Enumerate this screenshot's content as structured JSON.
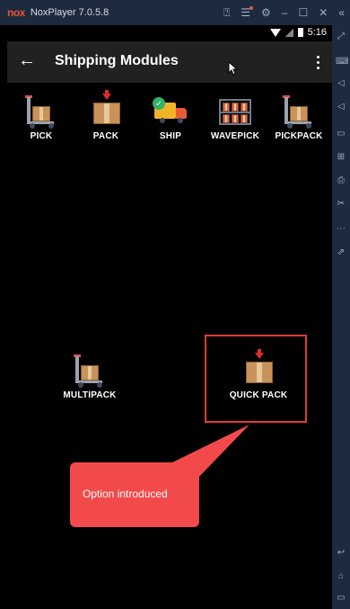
{
  "emulator": {
    "logo": "nox",
    "title": "NoxPlayer 7.0.5.8",
    "controls": [
      "help-icon",
      "menu-icon",
      "settings-icon",
      "minimize-icon",
      "maximize-icon",
      "close-icon",
      "collapse-icon"
    ]
  },
  "status_bar": {
    "time": "5:16"
  },
  "app_bar": {
    "title": "Shipping Modules"
  },
  "modules": [
    {
      "label": "PICK",
      "icon": "trolley-box-icon"
    },
    {
      "label": "PACK",
      "icon": "box-arrow-icon"
    },
    {
      "label": "SHIP",
      "icon": "truck-check-icon"
    },
    {
      "label": "WAVEPICK",
      "icon": "shelf-icon"
    },
    {
      "label": "PICKPACK",
      "icon": "trolley-box-icon"
    },
    {
      "label": "MULTIPACK",
      "icon": "trolley-box-icon"
    },
    {
      "label": "QUICK PACK",
      "icon": "box-arrow-icon"
    }
  ],
  "callout": {
    "text": "Option introduced"
  },
  "colors": {
    "emulator_bar": "#1e2a3d",
    "app_bar": "#212121",
    "highlight": "#e53935",
    "callout": "#f24a4a"
  }
}
